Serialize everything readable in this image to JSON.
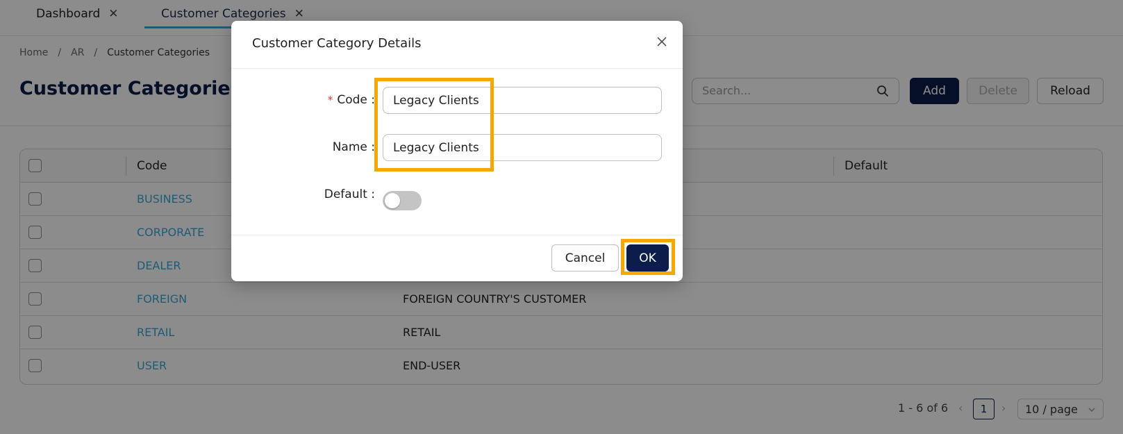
{
  "tabs": [
    {
      "label": "Dashboard"
    },
    {
      "label": "Customer Categories"
    }
  ],
  "breadcrumb": [
    "Home",
    "AR",
    "Customer Categories"
  ],
  "page_title": "Customer Categories",
  "toolbar": {
    "search_placeholder": "Search...",
    "add_label": "Add",
    "delete_label": "Delete",
    "reload_label": "Reload"
  },
  "table": {
    "headers": {
      "code": "Code",
      "default": "Default"
    },
    "rows": [
      {
        "code": "BUSINESS",
        "name": ""
      },
      {
        "code": "CORPORATE",
        "name": ""
      },
      {
        "code": "DEALER",
        "name": ""
      },
      {
        "code": "FOREIGN",
        "name": "FOREIGN COUNTRY'S CUSTOMER"
      },
      {
        "code": "RETAIL",
        "name": "RETAIL"
      },
      {
        "code": "USER",
        "name": "END-USER"
      }
    ]
  },
  "pagination": {
    "range": "1 - 6 of 6",
    "current_page": "1",
    "page_size": "10 / page"
  },
  "modal": {
    "title": "Customer Category Details",
    "code_label": "Code :",
    "code_required_mark": "*",
    "code_value": "Legacy Clients",
    "name_label": "Name :",
    "name_value": "Legacy Clients",
    "default_label": "Default :",
    "default_on": false,
    "cancel_label": "Cancel",
    "ok_label": "OK"
  },
  "colors": {
    "primary": "#0b1d4a",
    "link": "#3aa6d8",
    "highlight": "#f5a800",
    "required": "#e53935"
  }
}
